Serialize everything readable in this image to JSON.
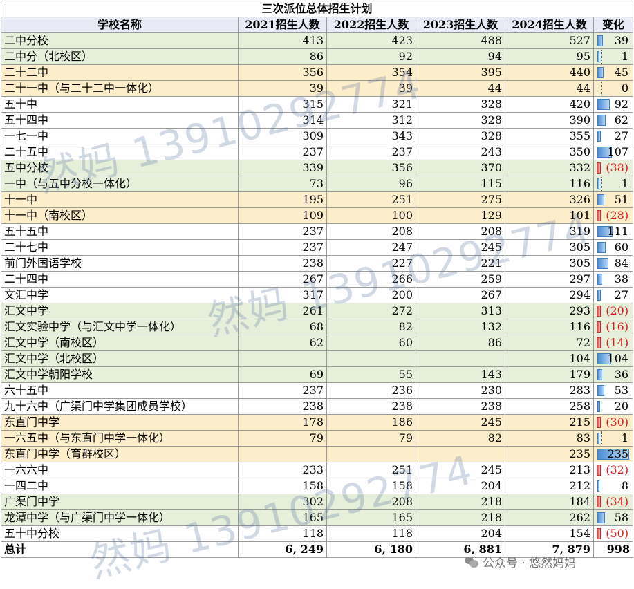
{
  "title": "三次派位总体招生计划",
  "headers": [
    "学校名称",
    "2021招生人数",
    "2022招生人数",
    "2023招生人数",
    "2024招生人数",
    "变化"
  ],
  "rows": [
    {
      "name": "二中分校",
      "y2021": "413",
      "y2022": "423",
      "y2023": "488",
      "y2024": "527",
      "change": "39",
      "change_value": 39,
      "tone": "g"
    },
    {
      "name": "二中分（北校区）",
      "y2021": "86",
      "y2022": "92",
      "y2023": "94",
      "y2024": "95",
      "change": "1",
      "change_value": 1,
      "tone": "g"
    },
    {
      "name": "二十二中",
      "y2021": "356",
      "y2022": "354",
      "y2023": "395",
      "y2024": "440",
      "change": "45",
      "change_value": 45,
      "tone": "y"
    },
    {
      "name": "二十一中（与二十二中一体化）",
      "y2021": "39",
      "y2022": "39",
      "y2023": "44",
      "y2024": "44",
      "change": "0",
      "change_value": 0,
      "tone": "y"
    },
    {
      "name": "五十中",
      "y2021": "315",
      "y2022": "321",
      "y2023": "328",
      "y2024": "420",
      "change": "92",
      "change_value": 92,
      "tone": "w"
    },
    {
      "name": "五十四中",
      "y2021": "314",
      "y2022": "312",
      "y2023": "328",
      "y2024": "390",
      "change": "62",
      "change_value": 62,
      "tone": "w"
    },
    {
      "name": "一七一中",
      "y2021": "309",
      "y2022": "343",
      "y2023": "328",
      "y2024": "355",
      "change": "27",
      "change_value": 27,
      "tone": "w"
    },
    {
      "name": "二十五中",
      "y2021": "237",
      "y2022": "237",
      "y2023": "243",
      "y2024": "350",
      "change": "107",
      "change_value": 107,
      "tone": "w"
    },
    {
      "name": "五中分校",
      "y2021": "339",
      "y2022": "356",
      "y2023": "370",
      "y2024": "332",
      "change": "(38)",
      "change_value": -38,
      "tone": "g"
    },
    {
      "name": "一中（与五中分校一体化）",
      "y2021": "73",
      "y2022": "96",
      "y2023": "115",
      "y2024": "116",
      "change": "1",
      "change_value": 1,
      "tone": "g"
    },
    {
      "name": "十一中",
      "y2021": "195",
      "y2022": "251",
      "y2023": "275",
      "y2024": "326",
      "change": "51",
      "change_value": 51,
      "tone": "y"
    },
    {
      "name": "十一中（南校区）",
      "y2021": "109",
      "y2022": "100",
      "y2023": "129",
      "y2024": "101",
      "change": "(28)",
      "change_value": -28,
      "tone": "y"
    },
    {
      "name": "五十五中",
      "y2021": "237",
      "y2022": "208",
      "y2023": "208",
      "y2024": "319",
      "change": "111",
      "change_value": 111,
      "tone": "w"
    },
    {
      "name": "二十七中",
      "y2021": "237",
      "y2022": "247",
      "y2023": "245",
      "y2024": "305",
      "change": "60",
      "change_value": 60,
      "tone": "w"
    },
    {
      "name": "前门外国语学校",
      "y2021": "238",
      "y2022": "227",
      "y2023": "221",
      "y2024": "305",
      "change": "84",
      "change_value": 84,
      "tone": "w"
    },
    {
      "name": "二十四中",
      "y2021": "267",
      "y2022": "266",
      "y2023": "259",
      "y2024": "297",
      "change": "38",
      "change_value": 38,
      "tone": "w"
    },
    {
      "name": "文汇中学",
      "y2021": "317",
      "y2022": "200",
      "y2023": "267",
      "y2024": "294",
      "change": "27",
      "change_value": 27,
      "tone": "w"
    },
    {
      "name": "汇文中学",
      "y2021": "261",
      "y2022": "272",
      "y2023": "313",
      "y2024": "293",
      "change": "(20)",
      "change_value": -20,
      "tone": "g"
    },
    {
      "name": "汇文实验中学（与汇文中学一体化）",
      "y2021": "68",
      "y2022": "82",
      "y2023": "132",
      "y2024": "116",
      "change": "(16)",
      "change_value": -16,
      "tone": "g"
    },
    {
      "name": "汇文中学（南校区）",
      "y2021": "62",
      "y2022": "60",
      "y2023": "86",
      "y2024": "72",
      "change": "(14)",
      "change_value": -14,
      "tone": "g"
    },
    {
      "name": "汇文中学（北校区）",
      "y2021": "",
      "y2022": "",
      "y2023": "",
      "y2024": "104",
      "change": "104",
      "change_value": 104,
      "tone": "g"
    },
    {
      "name": "汇文中学朝阳学校",
      "y2021": "69",
      "y2022": "55",
      "y2023": "143",
      "y2024": "179",
      "change": "36",
      "change_value": 36,
      "tone": "g"
    },
    {
      "name": "六十五中",
      "y2021": "237",
      "y2022": "236",
      "y2023": "230",
      "y2024": "283",
      "change": "53",
      "change_value": 53,
      "tone": "w"
    },
    {
      "name": "九十六中（广渠门中学集团成员学校）",
      "y2021": "238",
      "y2022": "238",
      "y2023": "238",
      "y2024": "258",
      "change": "20",
      "change_value": 20,
      "tone": "w"
    },
    {
      "name": "东直门中学",
      "y2021": "178",
      "y2022": "186",
      "y2023": "245",
      "y2024": "215",
      "change": "(30)",
      "change_value": -30,
      "tone": "y"
    },
    {
      "name": "一六五中（与东直门中学一体化）",
      "y2021": "79",
      "y2022": "79",
      "y2023": "82",
      "y2024": "83",
      "change": "1",
      "change_value": 1,
      "tone": "y"
    },
    {
      "name": "东直门中学（育群校区）",
      "y2021": "",
      "y2022": "",
      "y2023": "",
      "y2024": "235",
      "change": "235",
      "change_value": 235,
      "tone": "y"
    },
    {
      "name": "一六六中",
      "y2021": "233",
      "y2022": "251",
      "y2023": "245",
      "y2024": "213",
      "change": "(32)",
      "change_value": -32,
      "tone": "w"
    },
    {
      "name": "一四二中",
      "y2021": "158",
      "y2022": "158",
      "y2023": "204",
      "y2024": "212",
      "change": "8",
      "change_value": 8,
      "tone": "w"
    },
    {
      "name": "广渠门中学",
      "y2021": "302",
      "y2022": "208",
      "y2023": "218",
      "y2024": "184",
      "change": "(34)",
      "change_value": -34,
      "tone": "g"
    },
    {
      "name": "龙潭中学（与广渠门中学一体化）",
      "y2021": "165",
      "y2022": "165",
      "y2023": "218",
      "y2024": "262",
      "change": "58",
      "change_value": 58,
      "tone": "g"
    },
    {
      "name": "五十中分校",
      "y2021": "118",
      "y2022": "118",
      "y2023": "204",
      "y2024": "154",
      "change": "(50)",
      "change_value": -50,
      "tone": "w"
    }
  ],
  "total": {
    "label": "总计",
    "y2021": "6, 249",
    "y2022": "6, 180",
    "y2023": "6, 881",
    "y2024": "7, 879",
    "change": "998"
  },
  "watermark": {
    "text": "然妈 13910292774"
  },
  "footer_logo": {
    "text": "公众号 · 悠然妈妈",
    "icon": "wechat-icon"
  },
  "colors": {
    "header_bg": "#e8ebf6",
    "green_row": "#e6efda",
    "yellow_row": "#fdeecb",
    "positive_bar": "#4a8fd8",
    "negative_bar": "#d94040",
    "negative_text": "#e01e1e"
  }
}
